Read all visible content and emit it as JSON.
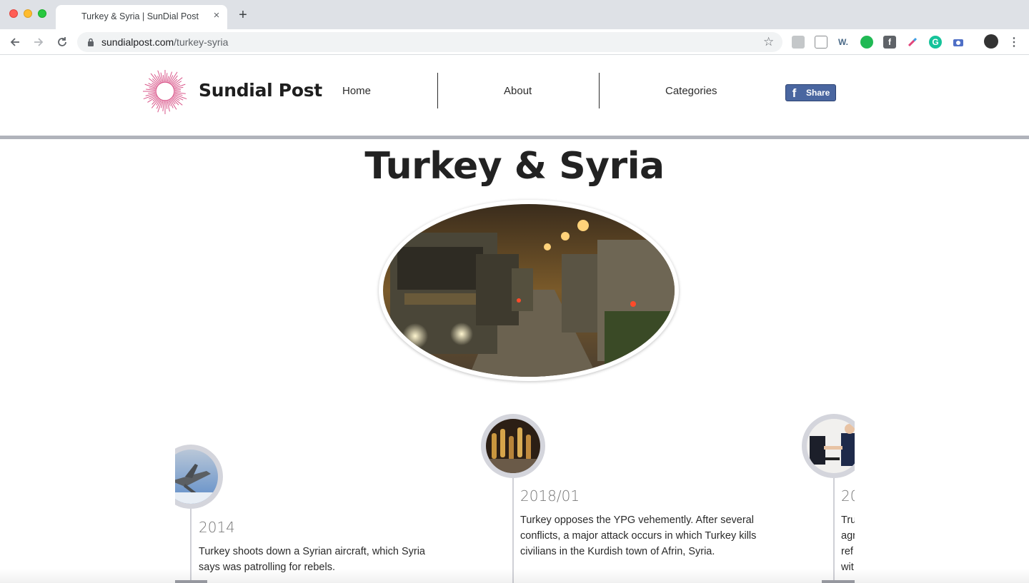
{
  "browser": {
    "tab_title": "Turkey & Syria | SunDial Post",
    "tab_close": "×",
    "new_tab": "+",
    "url_host": "sundialpost.com",
    "url_path": "/turkey-syria",
    "star_icon": "☆",
    "extensions": [
      "p-icon",
      "layout-icon",
      "w-icon",
      "evernote-icon",
      "facebook-icon",
      "pen-icon",
      "grammarly-icon",
      "camera-icon"
    ],
    "ext_w_label": "W.",
    "ext_f_label": "f",
    "ext_g_label": "G"
  },
  "header": {
    "brand": "Sundial Post",
    "nav": [
      {
        "label": "Home"
      },
      {
        "label": "About"
      },
      {
        "label": "Categories"
      }
    ],
    "fb_share": "Share",
    "fb_f": "f"
  },
  "page": {
    "title": "Turkey & Syria"
  },
  "timeline": [
    {
      "year": "2014",
      "text": "Turkey shoots down a Syrian aircraft, which Syria says was patrolling for rebels."
    },
    {
      "year": "2018/01",
      "text": "Turkey opposes the YPG vehemently. After several conflicts, a major attack occurs in which Turkey kills civilians in the Kurdish town of Afrin, Syria."
    },
    {
      "year": "20",
      "text_lines": [
        "Tru",
        "agr",
        "ref",
        "wit"
      ]
    }
  ],
  "colors": {
    "accent_pink": "#d9568a",
    "facebook": "#4a66a0",
    "rule": "#b0b3bb"
  }
}
